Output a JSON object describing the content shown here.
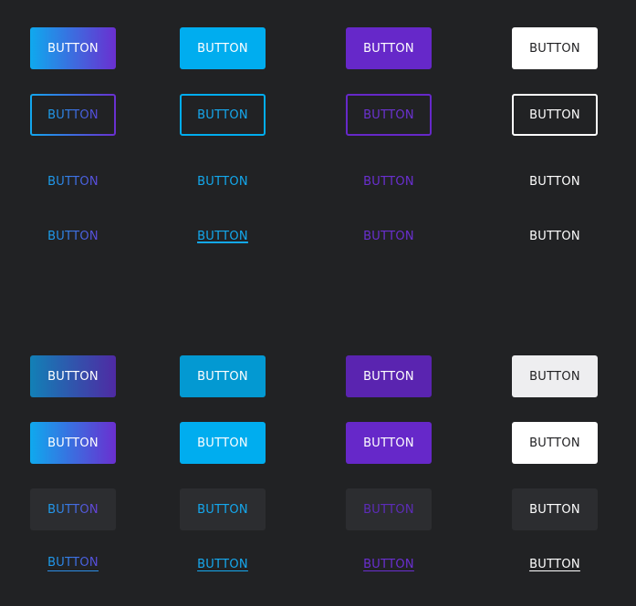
{
  "colors": {
    "background": "#212224",
    "gradient_start": "#0fa9ee",
    "gradient_end": "#6a2fd0",
    "cyan": "#00adef",
    "purple": "#6628c9",
    "white": "#ffffff"
  },
  "top_set": {
    "rows": [
      {
        "style": "filled",
        "labels": [
          "BUTTON",
          "BUTTON",
          "BUTTON",
          "BUTTON"
        ]
      },
      {
        "style": "outlined",
        "labels": [
          "BUTTON",
          "BUTTON",
          "BUTTON",
          "BUTTON"
        ]
      },
      {
        "style": "text",
        "labels": [
          "BUTTON",
          "BUTTON",
          "BUTTON",
          "BUTTON"
        ]
      },
      {
        "style": "text-link",
        "labels": [
          "BUTTON",
          "BUTTON",
          "BUTTON",
          "BUTTON"
        ]
      }
    ]
  },
  "bottom_set": {
    "rows": [
      {
        "style": "filled-pressed",
        "labels": [
          "BUTTON",
          "BUTTON",
          "BUTTON",
          "BUTTON"
        ]
      },
      {
        "style": "filled",
        "labels": [
          "BUTTON",
          "BUTTON",
          "BUTTON",
          "BUTTON"
        ]
      },
      {
        "style": "ghost",
        "labels": [
          "BUTTON",
          "BUTTON",
          "BUTTON",
          "BUTTON"
        ]
      },
      {
        "style": "link",
        "labels": [
          "BUTTON",
          "BUTTON",
          "BUTTON",
          "BUTTON"
        ]
      }
    ]
  }
}
